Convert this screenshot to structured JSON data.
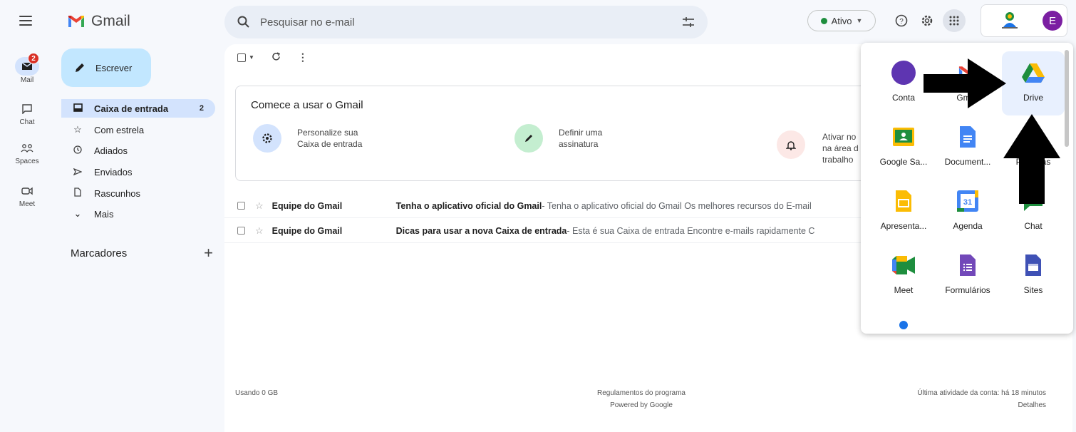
{
  "header": {
    "logo_text": "Gmail",
    "search_placeholder": "Pesquisar no e-mail",
    "status_label": "Ativo",
    "account_initial": "E"
  },
  "rail": {
    "items": [
      {
        "label": "Mail",
        "badge": "2"
      },
      {
        "label": "Chat"
      },
      {
        "label": "Spaces"
      },
      {
        "label": "Meet"
      }
    ]
  },
  "compose_label": "Escrever",
  "nav": {
    "items": [
      {
        "label": "Caixa de entrada",
        "count": "2"
      },
      {
        "label": "Com estrela"
      },
      {
        "label": "Adiados"
      },
      {
        "label": "Enviados"
      },
      {
        "label": "Rascunhos"
      },
      {
        "label": "Mais"
      }
    ],
    "labels_heading": "Marcadores"
  },
  "welcome": {
    "title": "Comece a usar o Gmail",
    "cards": [
      {
        "text1": "Personalize sua",
        "text2": "Caixa de entrada",
        "color": "#d3e3fd"
      },
      {
        "text1": "Definir uma",
        "text2": "assinatura",
        "color": "#c4eed0"
      },
      {
        "text1": "Ativar no",
        "text2": "na área d",
        "text3": "trabalho",
        "color": "#fce8e6"
      }
    ]
  },
  "emails": [
    {
      "sender": "Equipe do Gmail",
      "subject": "Tenha o aplicativo oficial do Gmail",
      "snippet": " - Tenha o aplicativo oficial do Gmail Os melhores recursos do E-mail"
    },
    {
      "sender": "Equipe do Gmail",
      "subject": "Dicas para usar a nova Caixa de entrada",
      "snippet": " - Esta é sua Caixa de entrada Encontre e-mails rapidamente C"
    }
  ],
  "footer": {
    "storage": "Usando 0 GB",
    "terms": "Regulamentos do programa",
    "powered": "Powered by Google",
    "activity": "Última atividade da conta: há 18 minutos",
    "details": "Detalhes"
  },
  "apps": [
    {
      "label": "Conta",
      "icon": "account-icon"
    },
    {
      "label": "Gmail",
      "icon": "gmail-icon"
    },
    {
      "label": "Drive",
      "icon": "drive-icon",
      "highlighted": true
    },
    {
      "label": "Google Sa...",
      "icon": "classroom-icon"
    },
    {
      "label": "Document...",
      "icon": "docs-icon"
    },
    {
      "label": "Planilhas",
      "icon": "sheets-icon"
    },
    {
      "label": "Apresenta...",
      "icon": "slides-icon"
    },
    {
      "label": "Agenda",
      "icon": "calendar-icon",
      "day": "31"
    },
    {
      "label": "Chat",
      "icon": "chat-icon"
    },
    {
      "label": "Meet",
      "icon": "meet-icon"
    },
    {
      "label": "Formulários",
      "icon": "forms-icon"
    },
    {
      "label": "Sites",
      "icon": "sites-icon"
    },
    {
      "label": "",
      "icon": "contacts-icon"
    }
  ],
  "colors": {
    "compose_bg": "#c2e7ff",
    "nav_active_bg": "#d3e3fd",
    "badge_red": "#d93025",
    "status_green": "#1e8e3e",
    "avatar_purple": "#7b1fa2"
  }
}
